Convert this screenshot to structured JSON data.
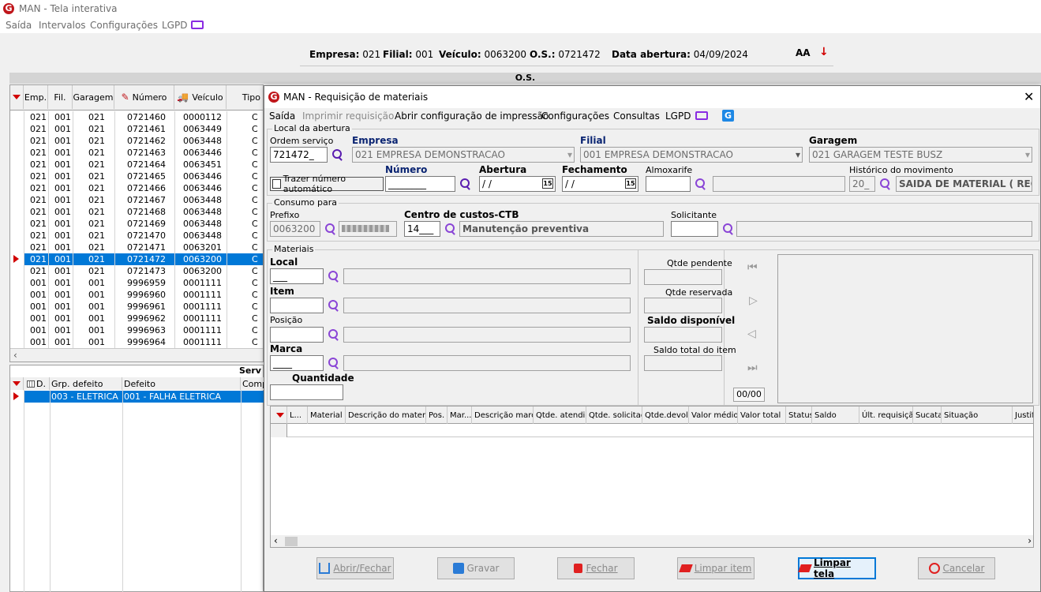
{
  "main": {
    "title": "MAN - Tela interativa",
    "menu": [
      "Saída",
      "Intervalos",
      "Configurações",
      "LGPD"
    ],
    "info": {
      "empresa_label": "Empresa:",
      "empresa": "021",
      "filial_label": "Filial:",
      "filial": "001",
      "veiculo_label": "Veículo:",
      "veiculo": "0063200",
      "os_label": "O.S.:",
      "os": "0721472",
      "data_label": "Data abertura:",
      "data": "04/09/2024"
    },
    "os_header": "O.S.",
    "columns": [
      "Emp.",
      "Fil.",
      "Garagem",
      "Número",
      "Veículo",
      "Tipo"
    ],
    "rows": [
      [
        "021",
        "001",
        "021",
        "0721460",
        "0000112",
        "C"
      ],
      [
        "021",
        "001",
        "021",
        "0721461",
        "0063449",
        "C"
      ],
      [
        "021",
        "001",
        "021",
        "0721462",
        "0063448",
        "C"
      ],
      [
        "021",
        "001",
        "021",
        "0721463",
        "0063446",
        "C"
      ],
      [
        "021",
        "001",
        "021",
        "0721464",
        "0063451",
        "C"
      ],
      [
        "021",
        "001",
        "021",
        "0721465",
        "0063446",
        "C"
      ],
      [
        "021",
        "001",
        "021",
        "0721466",
        "0063446",
        "C"
      ],
      [
        "021",
        "001",
        "021",
        "0721467",
        "0063448",
        "C"
      ],
      [
        "021",
        "001",
        "021",
        "0721468",
        "0063448",
        "C"
      ],
      [
        "021",
        "001",
        "021",
        "0721469",
        "0063448",
        "C"
      ],
      [
        "021",
        "001",
        "021",
        "0721470",
        "0063448",
        "C"
      ],
      [
        "021",
        "001",
        "021",
        "0721471",
        "0063201",
        "C"
      ],
      [
        "021",
        "001",
        "021",
        "0721472",
        "0063200",
        "C"
      ],
      [
        "021",
        "001",
        "021",
        "0721473",
        "0063200",
        "C"
      ],
      [
        "001",
        "001",
        "001",
        "9996959",
        "0001111",
        "C"
      ],
      [
        "001",
        "001",
        "001",
        "9996960",
        "0001111",
        "C"
      ],
      [
        "001",
        "001",
        "001",
        "9996961",
        "0001111",
        "C"
      ],
      [
        "001",
        "001",
        "001",
        "9996962",
        "0001111",
        "C"
      ],
      [
        "001",
        "001",
        "001",
        "9996963",
        "0001111",
        "C"
      ],
      [
        "001",
        "001",
        "001",
        "9996964",
        "0001111",
        "C"
      ]
    ],
    "selected_row": 12,
    "serv_header": "Serv",
    "serv_columns": [
      "D.",
      "Grp. defeito",
      "Defeito",
      "Comp"
    ],
    "serv_rows": [
      [
        "",
        "003 - ELETRICA",
        "001 - FALHA ELETRICA",
        ""
      ]
    ]
  },
  "dialog": {
    "title": "MAN - Requisição de materiais",
    "menu": [
      "Saída",
      "Imprimir requisição",
      "Abrir configuração de impressão",
      "Configurações",
      "Consultas",
      "LGPD"
    ],
    "local_abertura": {
      "group": "Local da abertura",
      "ordem_label": "Ordem serviço",
      "ordem": "721472_",
      "empresa_label": "Empresa",
      "empresa": "021 EMPRESA DEMONSTRACAO",
      "filial_label": "Filial",
      "filial": "001 EMPRESA DEMONSTRACAO",
      "garagem_label": "Garagem",
      "garagem": "021 GARAGEM TESTE BUSZ",
      "trazer_label": "Trazer número automático",
      "numero_label": "Número",
      "numero": "________",
      "abertura_label": "Abertura",
      "abertura": " / /",
      "fechamento_label": "Fechamento",
      "fechamento": " / /",
      "almox_label": "Almoxarife",
      "almox": "",
      "historico_label": "Histórico do movimento",
      "historico_code": "20_",
      "historico": "SAIDA DE MATERIAL ( REQU"
    },
    "consumo": {
      "group": "Consumo para",
      "prefixo_label": "Prefixo",
      "prefixo": "0063200",
      "cc_label": "Centro de custos-CTB",
      "cc": "14___",
      "cc_desc": "Manutenção preventiva",
      "solicitante_label": "Solicitante",
      "solicitante": ""
    },
    "materiais": {
      "group": "Materiais",
      "local_label": "Local",
      "local": "___",
      "item_label": "Item",
      "item": "",
      "posicao_label": "Posição",
      "posicao": "",
      "marca_label": "Marca",
      "marca": "____",
      "quantidade_label": "Quantidade",
      "quantidade": "",
      "qtde_pendente": "Qtde pendente",
      "qtde_reservada": "Qtde reservada",
      "saldo_disponivel": "Saldo disponível",
      "saldo_total": "Saldo total do item",
      "counter": "00/00"
    },
    "grid_columns": [
      "L...",
      "Material",
      "Descrição do material",
      "Pos.",
      "Mar...",
      "Descrição marca",
      "Qtde. atendida",
      "Qtde. solicitada",
      "Qtde.devolv.",
      "Valor médio",
      "Valor total",
      "Status",
      "Saldo",
      "Últ. requisição",
      "Sucata",
      "Situação",
      "Justifi"
    ],
    "buttons": {
      "abrir": "Abrir/Fechar",
      "gravar": "Gravar",
      "fechar": "Fechar",
      "limpar_item": "Limpar item",
      "limpar_tela": "Limpar tela",
      "cancelar": "Cancelar"
    }
  },
  "colors": {
    "accent": "#0078d7",
    "brand": "#c0161b",
    "search": "#8a45d6"
  }
}
